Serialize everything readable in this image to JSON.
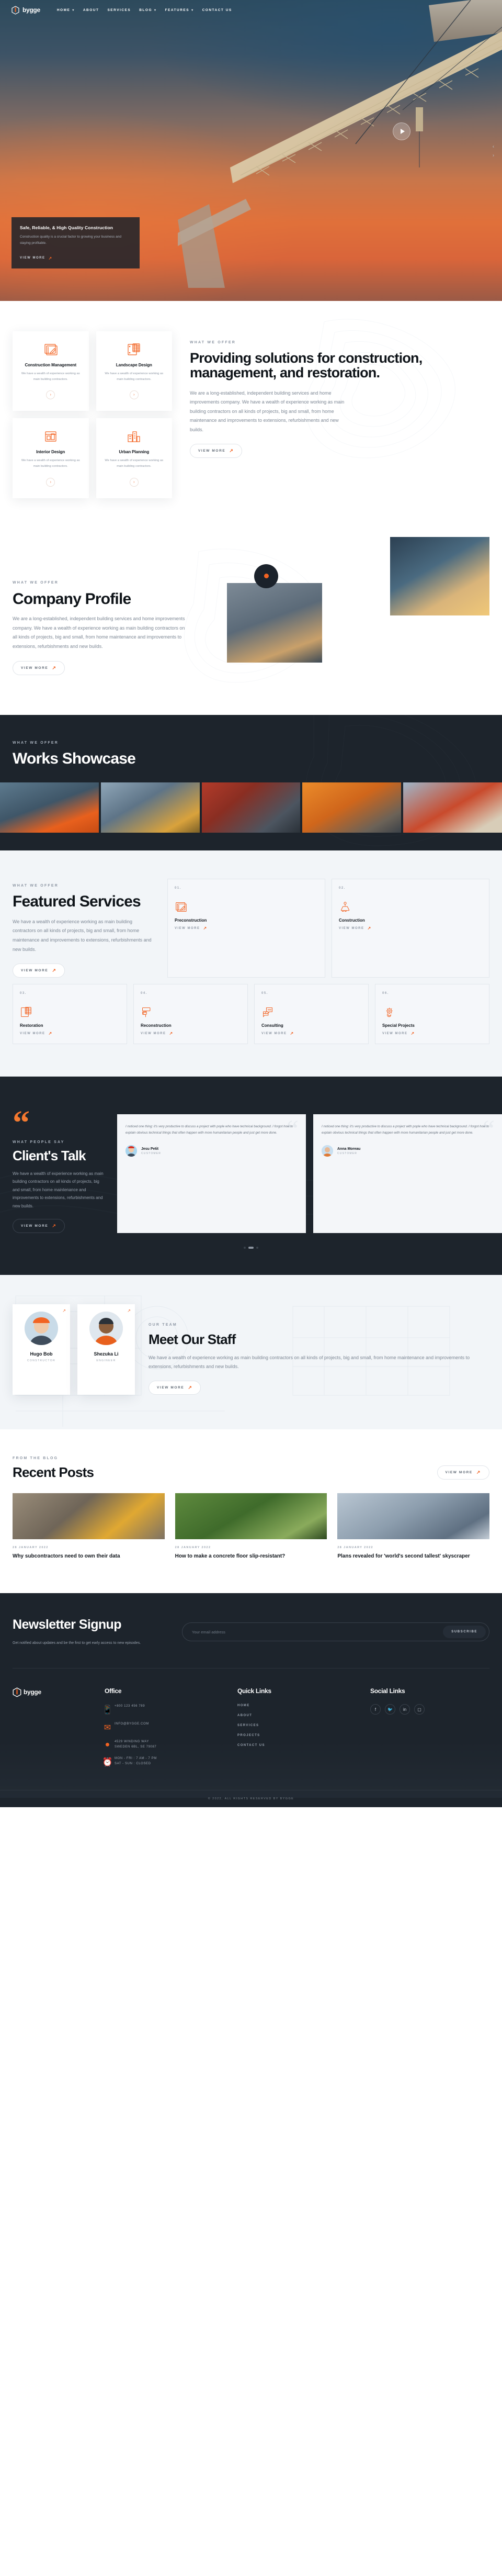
{
  "brand": {
    "name": "bygge",
    "logo_icon": "hexagon-logo-icon"
  },
  "nav": {
    "items": [
      {
        "label": "HOME",
        "caret": "∨"
      },
      {
        "label": "ABOUT",
        "caret": ""
      },
      {
        "label": "SERVICES",
        "caret": ""
      },
      {
        "label": "BLOG",
        "caret": "∨"
      },
      {
        "label": "FEATURES",
        "caret": "∨"
      },
      {
        "label": "CONTACT US",
        "caret": ""
      }
    ]
  },
  "hero": {
    "play_label": "play-button",
    "card_title": "Safe, Reliable, & High Quality Construction",
    "card_text": "Construction quality is a crucial factor to growing your business and staying profitable.",
    "card_link": "VIEW MORE",
    "arrow_prev": "‹",
    "arrow_next": "›"
  },
  "services_intro": {
    "eyebrow": "WHAT WE OFFER",
    "title": "Providing solutions for construction, management, and restoration.",
    "text": "We are a long-established, independent building services and home improvements company. We have a wealth of experience working as main building contractors on all kinds of projects, big and small, from home maintenance and improvements to extensions, refurbishments and new builds.",
    "button": "VIEW MORE",
    "cards": [
      {
        "icon": "blueprint-icon",
        "title": "Construction Management",
        "text": "We have a wealth of experience working as main building contractors.",
        "link": "›"
      },
      {
        "icon": "scaffold-icon",
        "title": "Landscape Design",
        "text": "We have a wealth of experience working as main building contractors.",
        "link": "›"
      },
      {
        "icon": "interior-icon",
        "title": "Interior Design",
        "text": "We have a wealth of experience working as main building contractors.",
        "link": "›"
      },
      {
        "icon": "city-icon",
        "title": "Urban Planning",
        "text": "We have a wealth of experience working as main building contractors.",
        "link": "›"
      }
    ]
  },
  "profile": {
    "eyebrow": "WHAT WE OFFER",
    "title": "Company Profile",
    "text": "We are a long-established, independent building services and home improvements company. We have a wealth of experience working as main building contractors on all kinds of projects, big and small, from home maintenance and improvements to extensions, refurbishments and new builds.",
    "button": "VIEW MORE"
  },
  "works": {
    "eyebrow": "WHAT WE OFFER",
    "title": "Works Showcase",
    "items": [
      {
        "name": "worker-portrait"
      },
      {
        "name": "crane-site"
      },
      {
        "name": "tunnel-boring"
      },
      {
        "name": "steel-structure"
      },
      {
        "name": "drilling-rig"
      }
    ]
  },
  "featured": {
    "eyebrow": "WHAT WE OFFER",
    "title": "Featured Services",
    "text": "We have a wealth of experience working as main building contractors on all kinds of projects, big and small, from home maintenance and improvements to extensions, refurbishments and new builds.",
    "button": "VIEW MORE",
    "link_label": "VIEW MORE",
    "cards": [
      {
        "num": "01.",
        "icon": "blueprint-icon",
        "title": "Preconstruction"
      },
      {
        "num": "02.",
        "icon": "crane-hook-icon",
        "title": "Construction"
      },
      {
        "num": "03.",
        "icon": "scaffold-icon",
        "title": "Restoration"
      },
      {
        "num": "04.",
        "icon": "paint-roller-icon",
        "title": "Reconstruction"
      },
      {
        "num": "05.",
        "icon": "chat-bricks-icon",
        "title": "Consulting"
      },
      {
        "num": "06.",
        "icon": "gear-bulb-icon",
        "title": "Special Projects"
      }
    ]
  },
  "testimonials": {
    "quote_mark": "“",
    "eyebrow": "WHAT PEOPLE SAY",
    "title": "Client's Talk",
    "text": "We have a wealth of experience working as main building contractors on all kinds of projects, big and small, from home maintenance and improvements to extensions, refurbishments and new builds.",
    "button": "VIEW MORE",
    "items": [
      {
        "quote": "I noticed one thing: it's very productive to discuss a project with pople who have technical background. I forgot how to explain obvious technical things that often happen with more humanitarian people and just get more done.",
        "name": "Jesu Petit",
        "role": "CUSTOMER"
      },
      {
        "quote": "I noticed one thing: it's very productive to discuss a project with pople who have technical background. I forgot how to explain obvious technical things that often happen with more humanitarian people and just get more done.",
        "name": "Anna Moreau",
        "role": "CUSTOMER"
      }
    ],
    "dots": 3,
    "active_dot": 1
  },
  "staff": {
    "eyebrow": "OUR TEAM",
    "title": "Meet Our Staff",
    "text": "We have a wealth of experience working as main building contractors on all kinds of projects, big and small, from home maintenance and improvements to extensions, refurbishments and new builds.",
    "button": "VIEW MORE",
    "members": [
      {
        "name": "Hugo Bob",
        "role": "CONSTRUCTOR"
      },
      {
        "name": "Shezuka Li",
        "role": "ENGINEER"
      }
    ]
  },
  "blog": {
    "eyebrow": "FROM THE BLOG",
    "title": "Recent Posts",
    "button": "VIEW MORE",
    "posts": [
      {
        "date": "28 JANUARY 2022",
        "title": "Why subcontractors need to own their data",
        "image": "aerial-excavator"
      },
      {
        "date": "28 JANUARY 2022",
        "title": "How to make a concrete floor slip-resistant?",
        "image": "green-park"
      },
      {
        "date": "28 JANUARY 2022",
        "title": "Plans revealed for 'world's second tallest' skyscraper",
        "image": "glass-tower"
      }
    ]
  },
  "newsletter": {
    "title": "Newsletter Signup",
    "text": "Get notified about updates and be the first to get early access to new episodes.",
    "placeholder": "Your email address",
    "value": "",
    "button": "SUBSCRIBE"
  },
  "footer": {
    "brand": "bygge",
    "office": {
      "heading": "Office",
      "rows": [
        {
          "icon": "phone-icon",
          "text": "+800 123 456 789"
        },
        {
          "icon": "mail-icon",
          "text": "INFO@BYGGE.COM"
        },
        {
          "icon": "pin-icon",
          "text": "4529 WINDING WAY\nSWEDEN 6BL, SE 79087"
        },
        {
          "icon": "clock-icon",
          "text": "MON - FRI : 7 AM - 7 PM\nSAT - SUN : CLOSED"
        }
      ]
    },
    "quick": {
      "heading": "Quick Links",
      "items": [
        "HOME",
        "ABOUT",
        "SERVICES",
        "PROJECTS",
        "CONTACT US"
      ]
    },
    "social": {
      "heading": "Social Links",
      "items": [
        "f",
        "🐦",
        "in",
        "◎"
      ]
    },
    "copyright": "© 2022, ALL RIGHTS RESERVED BY BYGGE"
  },
  "colors": {
    "accent": "#f26322",
    "dark": "#1d242c",
    "light": "#f2f5f8"
  }
}
